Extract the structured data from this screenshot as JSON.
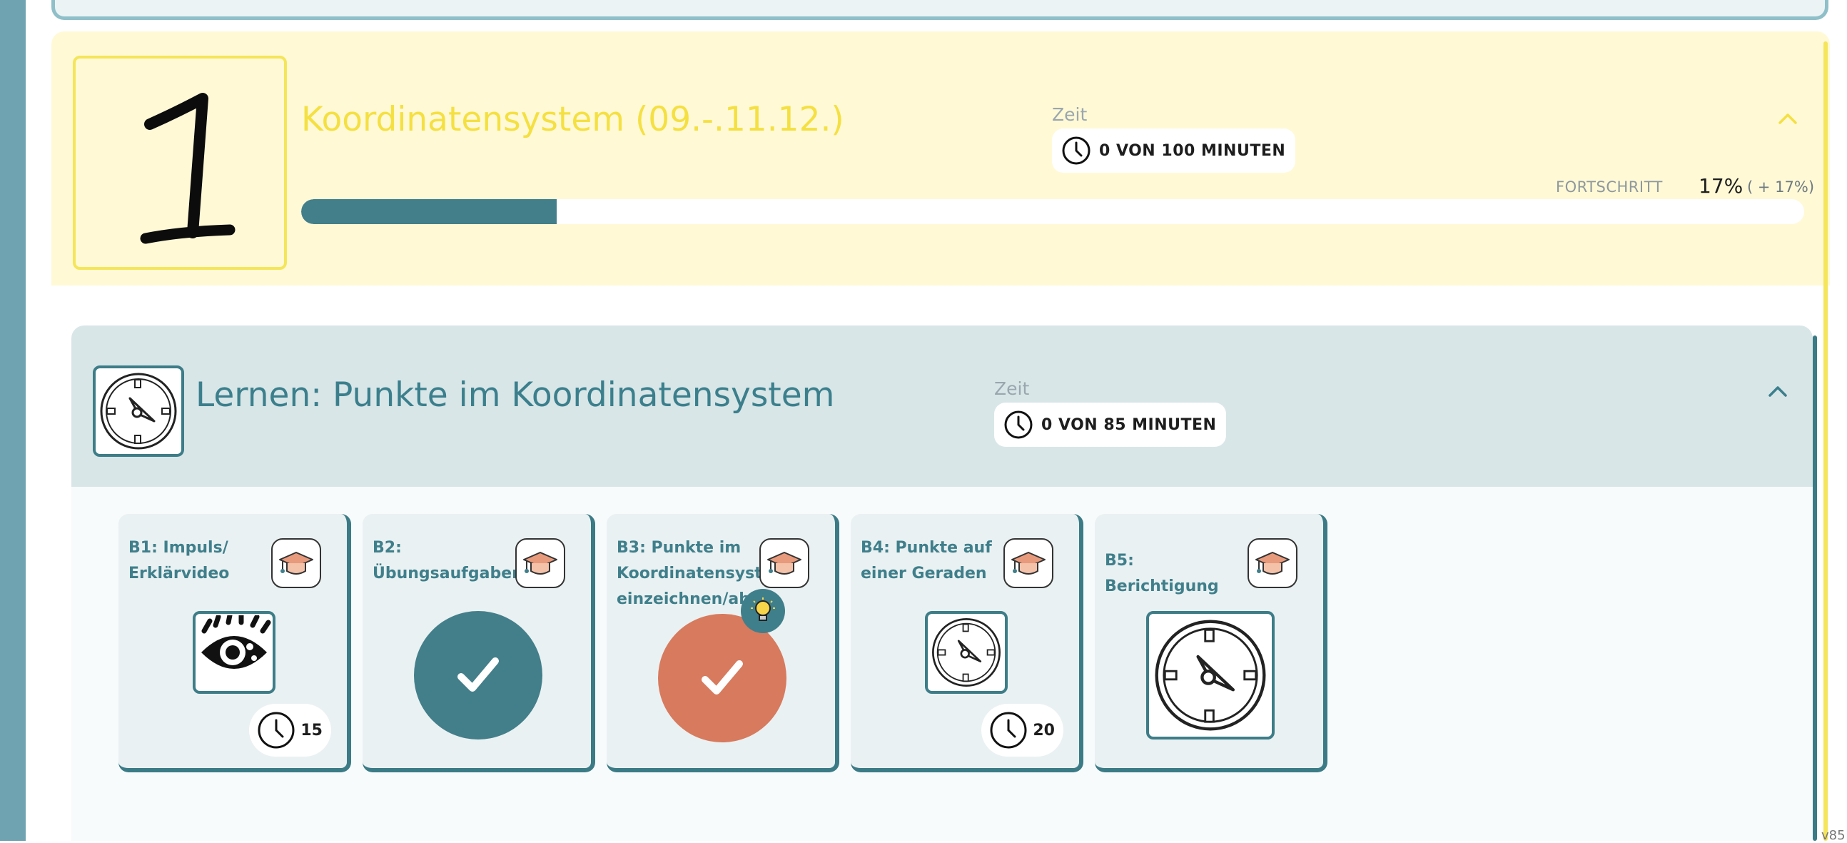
{
  "chapter": {
    "number": "1",
    "title": "Koordinatensystem (09.-.11.12.)",
    "time_label": "Zeit",
    "time_value": "0 VON 100 MINUTEN",
    "progress_label": "FORTSCHRITT",
    "progress_value": "17%",
    "progress_delta": "( + 17%)",
    "progress_fraction": 0.17
  },
  "unit": {
    "title": "Lernen: Punkte im Koordinatensystem",
    "time_label": "Zeit",
    "time_value": "0 VON 85 MINUTEN"
  },
  "cards": [
    {
      "title": "B1: Impuls/ Erklärvideo",
      "visual": "eye-icon",
      "status": "open",
      "minutes": "15"
    },
    {
      "title": "B2: Übungsaufgaben",
      "visual": "check-icon",
      "status": "done",
      "color": "#437f8a"
    },
    {
      "title": "B3: Punkte im Koordinatensystem einzeichnen/ablesen",
      "visual": "check-icon",
      "status": "done",
      "color": "#d77a5d",
      "hint": "lightbulb-icon"
    },
    {
      "title": "B4: Punkte auf einer Geraden",
      "visual": "compass-icon",
      "status": "open",
      "minutes": "20"
    },
    {
      "title": "B5: Berichtigung",
      "visual": "compass-icon",
      "status": "open"
    }
  ],
  "colors": {
    "accent_teal": "#437f8a",
    "accent_orange": "#d77a5d",
    "chapter_yellow": "#f5e042",
    "chapter_bg": "#fff9d6"
  },
  "version": "v85"
}
